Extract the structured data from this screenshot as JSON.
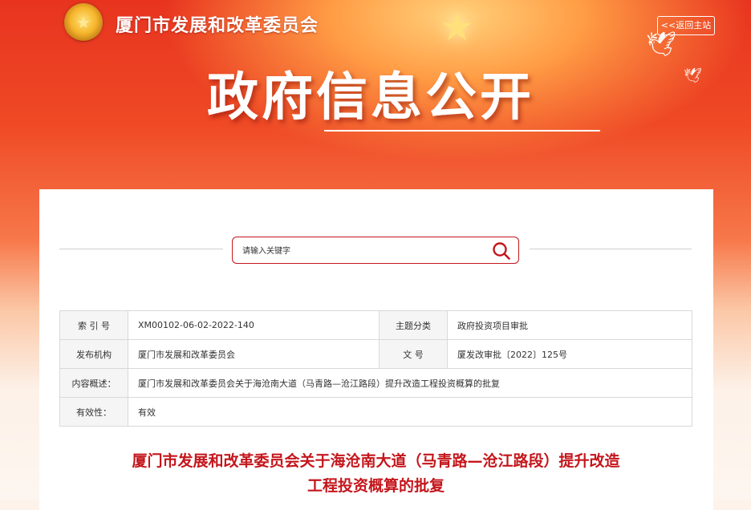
{
  "header": {
    "site_name": "厦门市发展和改革委员会",
    "return_link": "<<返回主站",
    "page_heading": "政府信息公开"
  },
  "search": {
    "placeholder": "请输入关键字"
  },
  "meta_table": {
    "rows": [
      {
        "label1": "索 引 号",
        "value1": "XM00102-06-02-2022-140",
        "label2": "主题分类",
        "value2": "政府投资项目审批"
      },
      {
        "label1": "发布机构",
        "value1": "厦门市发展和改革委员会",
        "label2": "文 号",
        "value2": "厦发改审批〔2022〕125号"
      },
      {
        "label1": "内容概述：",
        "value1": "厦门市发展和改革委员会关于海沧南大道（马青路—沧江路段）提升改造工程投资概算的批复"
      },
      {
        "label1": "有效性：",
        "value1": "有效"
      }
    ]
  },
  "document": {
    "title_line1": "厦门市发展和改革委员会关于海沧南大道（马青路—沧江路段）提升改造",
    "title_line2": "工程投资概算的批复"
  },
  "colors": {
    "accent": "#c4161c",
    "banner_red": "#e8341f"
  },
  "icons": [
    "national-emblem-icon",
    "dove-icon",
    "star-icon",
    "search-icon"
  ]
}
